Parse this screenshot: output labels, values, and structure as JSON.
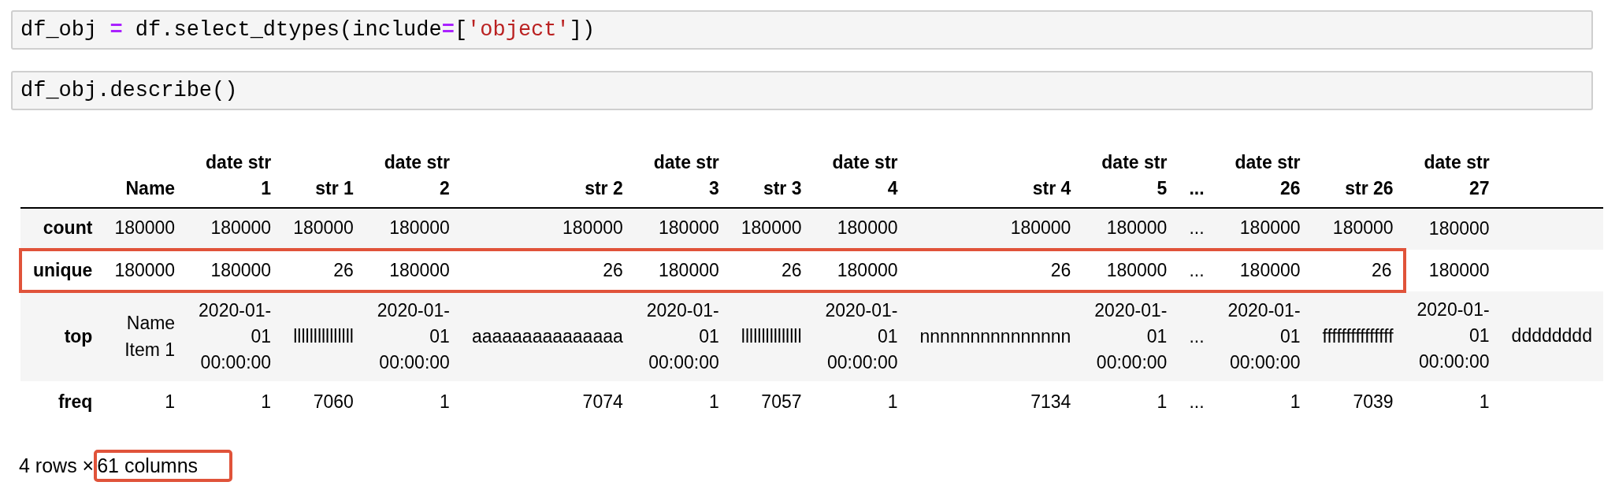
{
  "code_cells": [
    {
      "tokens": [
        {
          "kind": "name",
          "text": "df_obj "
        },
        {
          "kind": "operator",
          "text": "="
        },
        {
          "kind": "name",
          "text": " df.select_dtypes(include"
        },
        {
          "kind": "operator",
          "text": "="
        },
        {
          "kind": "name",
          "text": "["
        },
        {
          "kind": "string",
          "text": "'object'"
        },
        {
          "kind": "name",
          "text": "])"
        }
      ]
    },
    {
      "tokens": [
        {
          "kind": "name",
          "text": "df_obj.describe()"
        }
      ]
    }
  ],
  "table": {
    "columns": [
      {
        "kind": "name",
        "label": "Name"
      },
      {
        "kind": "date",
        "label": "date str 1"
      },
      {
        "kind": "str",
        "label": "str 1"
      },
      {
        "kind": "date",
        "label": "date str 2"
      },
      {
        "kind": "str",
        "label": "str 2"
      },
      {
        "kind": "date",
        "label": "date str 3"
      },
      {
        "kind": "str",
        "label": "str 3"
      },
      {
        "kind": "date",
        "label": "date str 4"
      },
      {
        "kind": "str",
        "label": "str 4"
      },
      {
        "kind": "date",
        "label": "date str 5"
      },
      {
        "kind": "ellipsis",
        "label": "..."
      },
      {
        "kind": "date",
        "label": "date str 26"
      },
      {
        "kind": "str",
        "label": "str 26"
      },
      {
        "kind": "date",
        "label": "date str 27"
      },
      {
        "kind": "str"
      }
    ],
    "rows": [
      {
        "label": "count",
        "cells": [
          "180000",
          "180000",
          "180000",
          "180000",
          "180000",
          "180000",
          "180000",
          "180000",
          "180000",
          "180000",
          "...",
          "180000",
          "180000",
          "180000"
        ]
      },
      {
        "label": "unique",
        "highlighted": true,
        "cells": [
          {
            "text": "180000",
            "highlighted": true
          },
          {
            "text": "180000",
            "highlighted": true
          },
          {
            "text": "26",
            "highlighted": true
          },
          {
            "text": "180000",
            "highlighted": true
          },
          {
            "text": "26",
            "highlighted": true
          },
          {
            "text": "180000",
            "highlighted": true
          },
          {
            "text": "26",
            "highlighted": true
          },
          {
            "text": "180000",
            "highlighted": true
          },
          {
            "text": "26",
            "highlighted": true
          },
          {
            "text": "180000",
            "highlighted": true
          },
          {
            "text": "...",
            "highlighted": true
          },
          {
            "text": "180000",
            "highlighted": true
          },
          {
            "text": "26",
            "highlighted": true
          },
          {
            "text": "180000",
            "highlighted": false
          }
        ]
      },
      {
        "label": "top",
        "cells": [
          "Name Item 1",
          "2020-01-01 00:00:00",
          "lllllllllllllll",
          "2020-01-01 00:00:00",
          "aaaaaaaaaaaaaaa",
          "2020-01-01 00:00:00",
          "lllllllllllllll",
          "2020-01-01 00:00:00",
          "nnnnnnnnnnnnnnn",
          "2020-01-01 00:00:00",
          "...",
          "2020-01-01 00:00:00",
          "fffffffffffffff",
          "2020-01-01 00:00:00",
          "dddddddd"
        ]
      },
      {
        "label": "freq",
        "cells": [
          "1",
          "1",
          "7060",
          "1",
          "7074",
          "1",
          "7057",
          "1",
          "7134",
          "1",
          "...",
          "1",
          "7039",
          "1"
        ]
      }
    ]
  },
  "footer": {
    "parts": [
      {
        "text": "4 rows × ",
        "highlighted": false
      },
      {
        "text": "61 columns",
        "highlighted": true
      }
    ]
  }
}
